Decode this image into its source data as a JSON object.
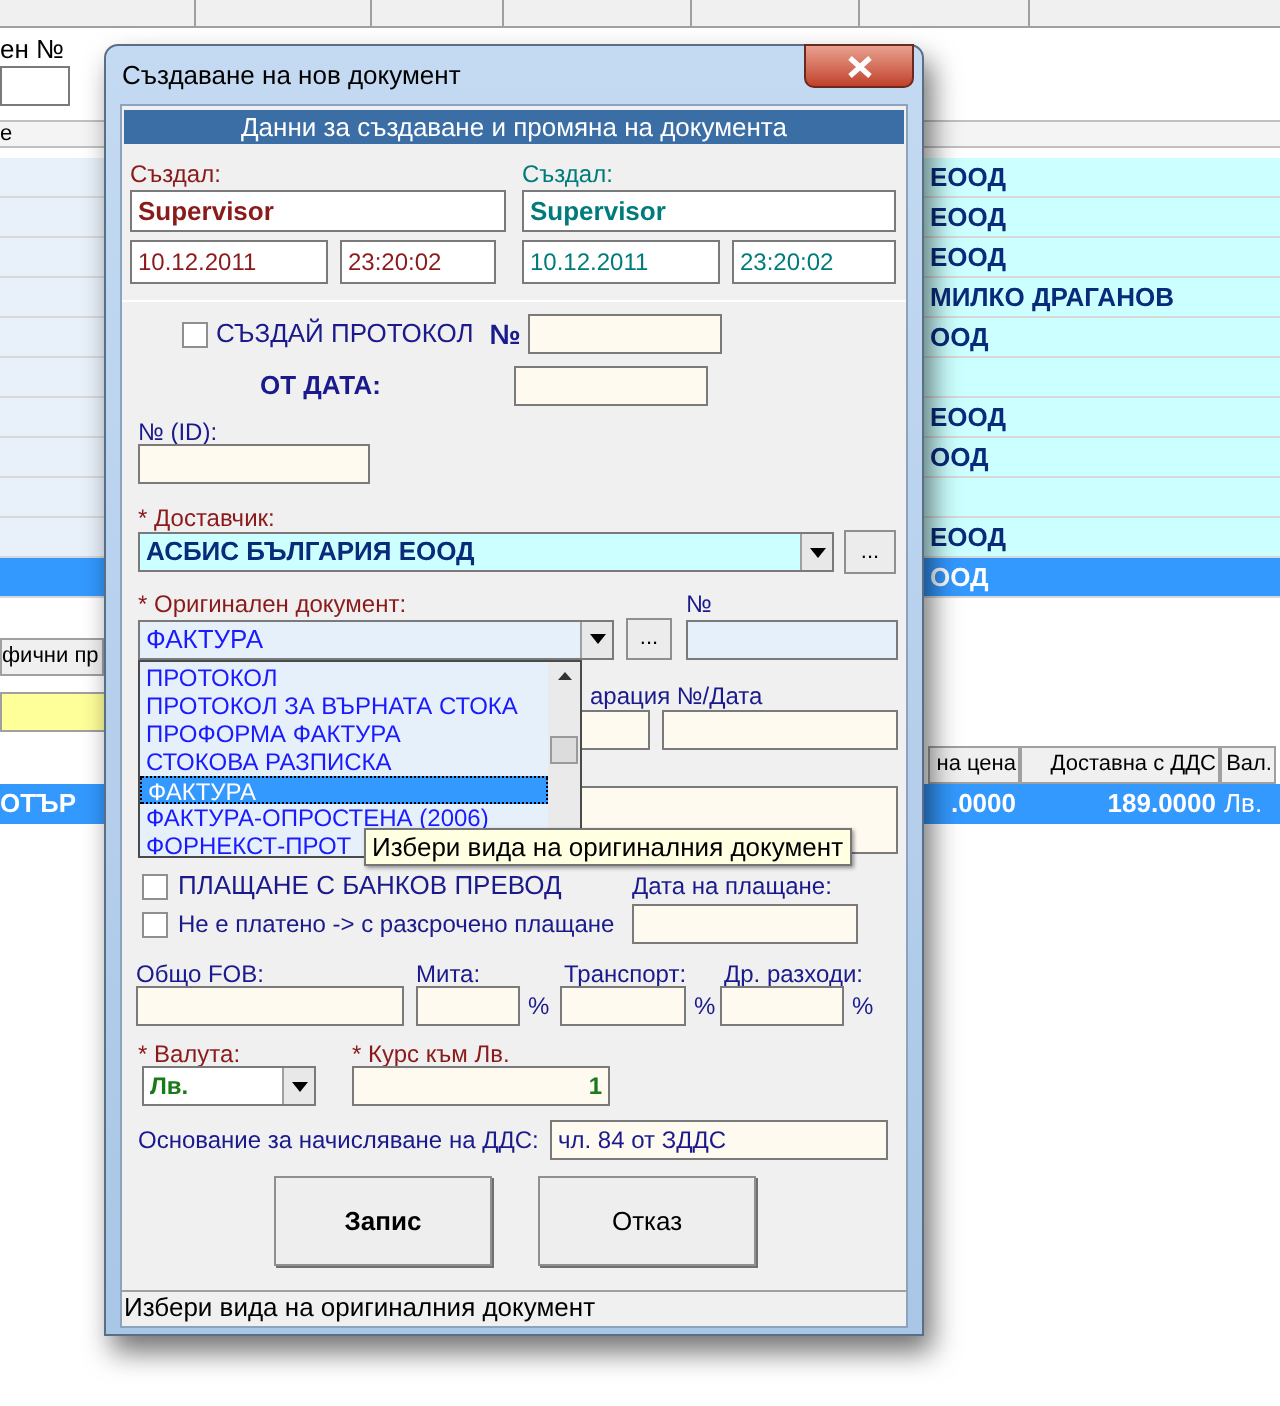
{
  "background": {
    "search_label": "ен №",
    "list_header": "е",
    "rows": [
      {
        "text": "ЕООД",
        "selected": false
      },
      {
        "text": "ЕООД",
        "selected": false
      },
      {
        "text": "ЕООД",
        "selected": false
      },
      {
        "text": "МИЛКО ДРАГАНОВ",
        "selected": false
      },
      {
        "text": "ООД",
        "selected": false
      },
      {
        "text": "",
        "selected": false
      },
      {
        "text": "ЕООД",
        "selected": false
      },
      {
        "text": "ООД",
        "selected": false
      },
      {
        "text": "",
        "selected": false
      },
      {
        "text": "ЕООД",
        "selected": false
      },
      {
        "text": "ООД",
        "selected": true
      }
    ],
    "tab": "фични пр",
    "grid": {
      "columns": [
        "на цена",
        "Доставна с ДДС",
        "Вал."
      ],
      "row": {
        "first": "ОТЪР",
        "cells": [
          ".0000",
          "189.0000",
          "Лв."
        ],
        "selected": true
      }
    }
  },
  "dialog": {
    "title": "Създаване на нов документ",
    "section_header": "Данни за създаване и промяна на документа",
    "created": {
      "label": "Създал:",
      "user": "Supervisor",
      "date": "10.12.2011",
      "time": "23:20:02"
    },
    "modified": {
      "label": "Създал:",
      "user": "Supervisor",
      "date": "10.12.2011",
      "time": "23:20:02"
    },
    "protocol": {
      "checked": false,
      "label": "СЪЗДАЙ ПРОТОКОЛ",
      "number_label": "№",
      "date_label": "ОТ ДАТА:"
    },
    "id_label": "№ (ID):",
    "supplier": {
      "label": "* Доставчик:",
      "value": "АСБИС БЪЛГАРИЯ ЕООД",
      "button": "..."
    },
    "original": {
      "label": "* Оригинален документ:",
      "value": "ФАКТУРА",
      "button": "...",
      "number_label": "№"
    },
    "dropdown": [
      {
        "label": "ПРОТОКОЛ",
        "selected": false
      },
      {
        "label": "ПРОТОКОЛ ЗА ВЪРНАТА СТОКА",
        "selected": false
      },
      {
        "label": "ПРОФОРМА ФАКТУРА",
        "selected": false
      },
      {
        "label": "СТОКОВА РАЗПИСКА",
        "selected": false
      },
      {
        "label": "ФАКТУРА",
        "selected": true
      },
      {
        "label": "ФАКТУРА-ОПРОСТЕНА (2006)",
        "selected": false
      },
      {
        "label": "ФОРНЕКСТ-ПРОТ",
        "selected": false
      }
    ],
    "tooltip": "Избери вида на оригиналния документ",
    "declaration_label": "арация №/Дата",
    "payment_options": [
      {
        "label": "ПЛАЩАНЕ С БАНКОВ ПРЕВОД",
        "checked": false
      },
      {
        "label": "Не е платено -> с разсрочено плащане",
        "checked": false
      }
    ],
    "payment_date_label": "Дата на плащане:",
    "costs": [
      {
        "label": "Общо FOB:"
      },
      {
        "label": "Мита:",
        "unit": "%"
      },
      {
        "label": "Транспорт:",
        "unit": "%"
      },
      {
        "label": "Др. разходи:",
        "unit": "%"
      }
    ],
    "currency": {
      "label": "* Валута:",
      "value": "Лв."
    },
    "rate": {
      "label": "* Курс към Лв.",
      "value": "1"
    },
    "vat": {
      "label": "Основание за начисляване на ДДС:",
      "value": "чл. 84 от ЗДДС"
    },
    "buttons": [
      {
        "label": "Запис",
        "default": true
      },
      {
        "label": "Отказ",
        "default": false
      }
    ],
    "status": "Избери вида на оригиналния документ"
  }
}
